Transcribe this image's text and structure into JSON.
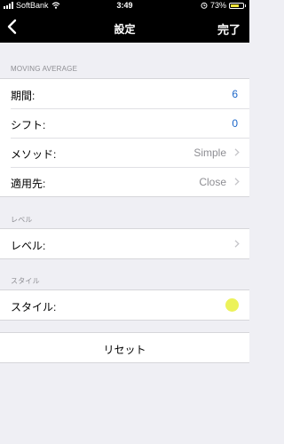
{
  "status": {
    "carrier": "SoftBank",
    "time": "3:49",
    "battery": "73%",
    "battery_level": 0.73,
    "battery_color": "#f0e43a"
  },
  "nav": {
    "title": "設定",
    "done": "完了"
  },
  "sections": {
    "moving_average": {
      "header": "MOVING AVERAGE",
      "period_label": "期間:",
      "period_value": "6",
      "shift_label": "シフト:",
      "shift_value": "0",
      "method_label": "メソッド:",
      "method_value": "Simple",
      "apply_label": "適用先:",
      "apply_value": "Close"
    },
    "level": {
      "header": "レベル",
      "level_label": "レベル:"
    },
    "style": {
      "header": "スタイル",
      "style_label": "スタイル:",
      "style_color": "#ecf25a"
    }
  },
  "reset": {
    "label": "リセット"
  },
  "colors": {
    "value_blue": "#1a66c9",
    "background": "#efeff4"
  }
}
